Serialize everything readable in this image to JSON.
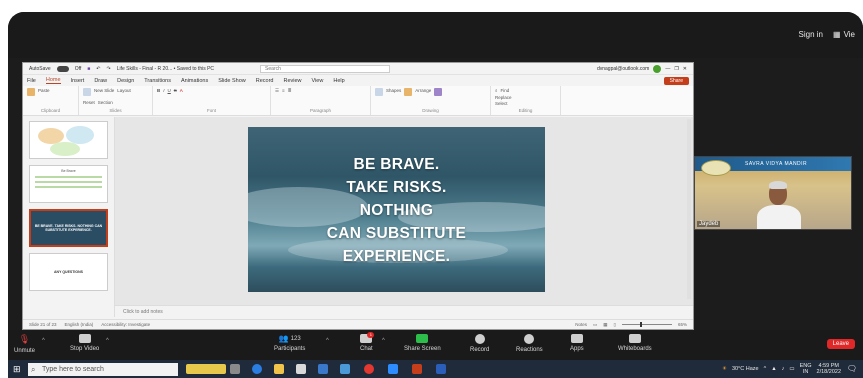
{
  "zoom_top": {
    "signin_label": "Sign in",
    "view_label": "Vie"
  },
  "ppt": {
    "autosave_label": "AutoSave",
    "autosave_state": "Off",
    "file_title": "Life Skills - Final - R 20... • Saved to this PC",
    "search_placeholder": "Search",
    "user_email": "dvnagpal@outlook.com",
    "menu": [
      "File",
      "Home",
      "Insert",
      "Draw",
      "Design",
      "Transitions",
      "Animations",
      "Slide Show",
      "Record",
      "Review",
      "View",
      "Help"
    ],
    "active_menu": "Home",
    "share_label": "Share",
    "ribbon_groups": [
      "Clipboard",
      "Slides",
      "Font",
      "Paragraph",
      "Drawing",
      "Editing"
    ],
    "ribbon_items": {
      "paste": "Paste",
      "new_slide": "New Slide",
      "layout": "Layout",
      "reset": "Reset",
      "section": "Section",
      "shapes": "Shapes",
      "arrange": "Arrange",
      "find": "Find",
      "replace": "Replace",
      "select": "Select"
    },
    "slide_lines": [
      "BE BRAVE.",
      "TAKE RISKS.",
      "NOTHING",
      "CAN SUBSTITUTE",
      "EXPERIENCE."
    ],
    "thumb_selected_text": "BE BRAVE. TAKE RISKS. NOTHING CAN SUBSTITUTE EXPERIENCE.",
    "thumb_title_2": "Be Brave",
    "thumb_title_4": "ANY QUESTIONS",
    "notes_placeholder": "Click to add notes",
    "status": {
      "slide_counter": "Slide 21 of 23",
      "language": "English (India)",
      "accessibility": "Accessibility: Investigate",
      "notes": "Notes",
      "zoom": "65%"
    }
  },
  "video": {
    "banner_text": "SAVRA VIDYA MANDIR",
    "participant_name": "Jaydeb"
  },
  "toolbar": {
    "unmute_label": "Unmute",
    "stop_video_label": "Stop Video",
    "participants_label": "Participants",
    "participants_count": "123",
    "chat_label": "Chat",
    "chat_badge": "1",
    "share_screen_label": "Share Screen",
    "record_label": "Record",
    "reactions_label": "Reactions",
    "apps_label": "Apps",
    "whiteboards_label": "Whiteboards",
    "leave_label": "Leave"
  },
  "taskbar": {
    "search_placeholder": "Type here to search",
    "weather": "30°C Haze",
    "lang": "ENG",
    "lang_region": "IN",
    "time": "4:59 PM",
    "date": "2/18/2022"
  }
}
